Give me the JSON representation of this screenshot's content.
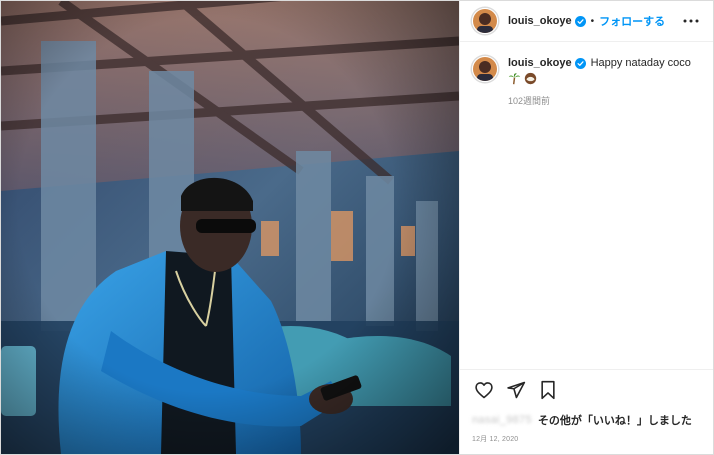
{
  "header": {
    "username": "louis_okoye",
    "separator": "•",
    "follow_label": "フォローする"
  },
  "caption": {
    "username": "louis_okoye",
    "text": "Happy nataday coco",
    "emojis": [
      "palm-tree-emoji",
      "coconut-emoji"
    ],
    "time": "102週間前"
  },
  "likes": {
    "blurred_user": "nasai_9875",
    "text": "その他が「いいね！」しました"
  },
  "post_date": "12月 12, 2020",
  "colors": {
    "accent": "#0095f6",
    "verified": "#0095f6",
    "muted": "#8e8e8e"
  },
  "icons": {
    "more": "more-horizontal-icon",
    "like": "heart-icon",
    "share": "send-icon",
    "save": "bookmark-icon"
  }
}
